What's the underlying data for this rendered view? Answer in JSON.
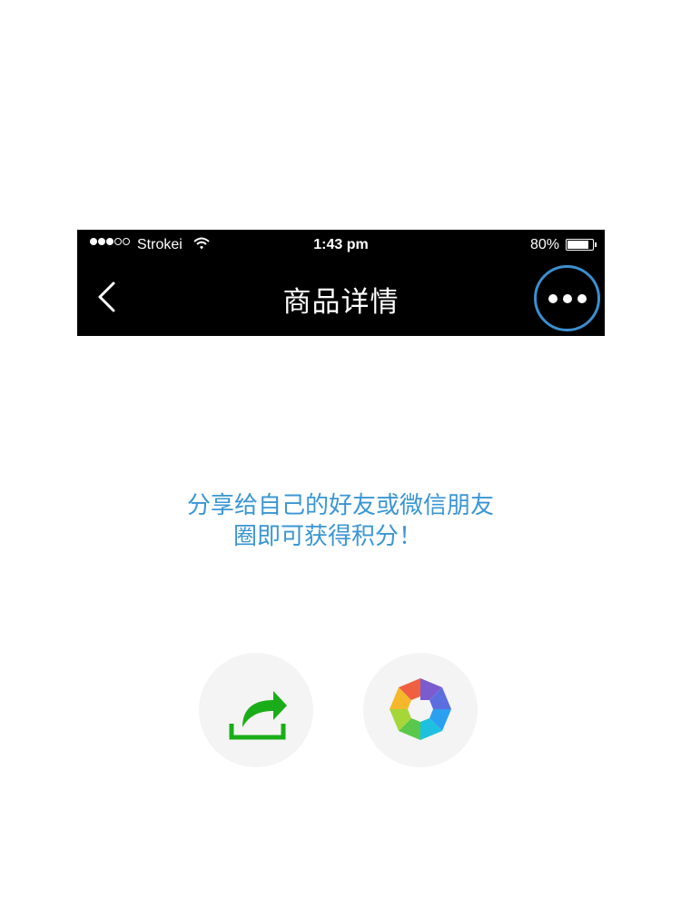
{
  "status_bar": {
    "carrier": "Strokei",
    "time": "1:43 pm",
    "battery": "80%"
  },
  "nav": {
    "title": "商品详情",
    "back_icon": "chevron-left-icon",
    "more_icon": "more-dots-icon"
  },
  "share": {
    "line1": "分享给自己的好友或微信朋友",
    "line2": "圈即可获得积分！"
  },
  "actions": [
    {
      "icon": "share-arrow-icon",
      "color": "#1aad19"
    },
    {
      "icon": "moments-aperture-icon"
    }
  ],
  "colors": {
    "accent_blue": "#3a96d4",
    "bar_bg": "#000000"
  }
}
